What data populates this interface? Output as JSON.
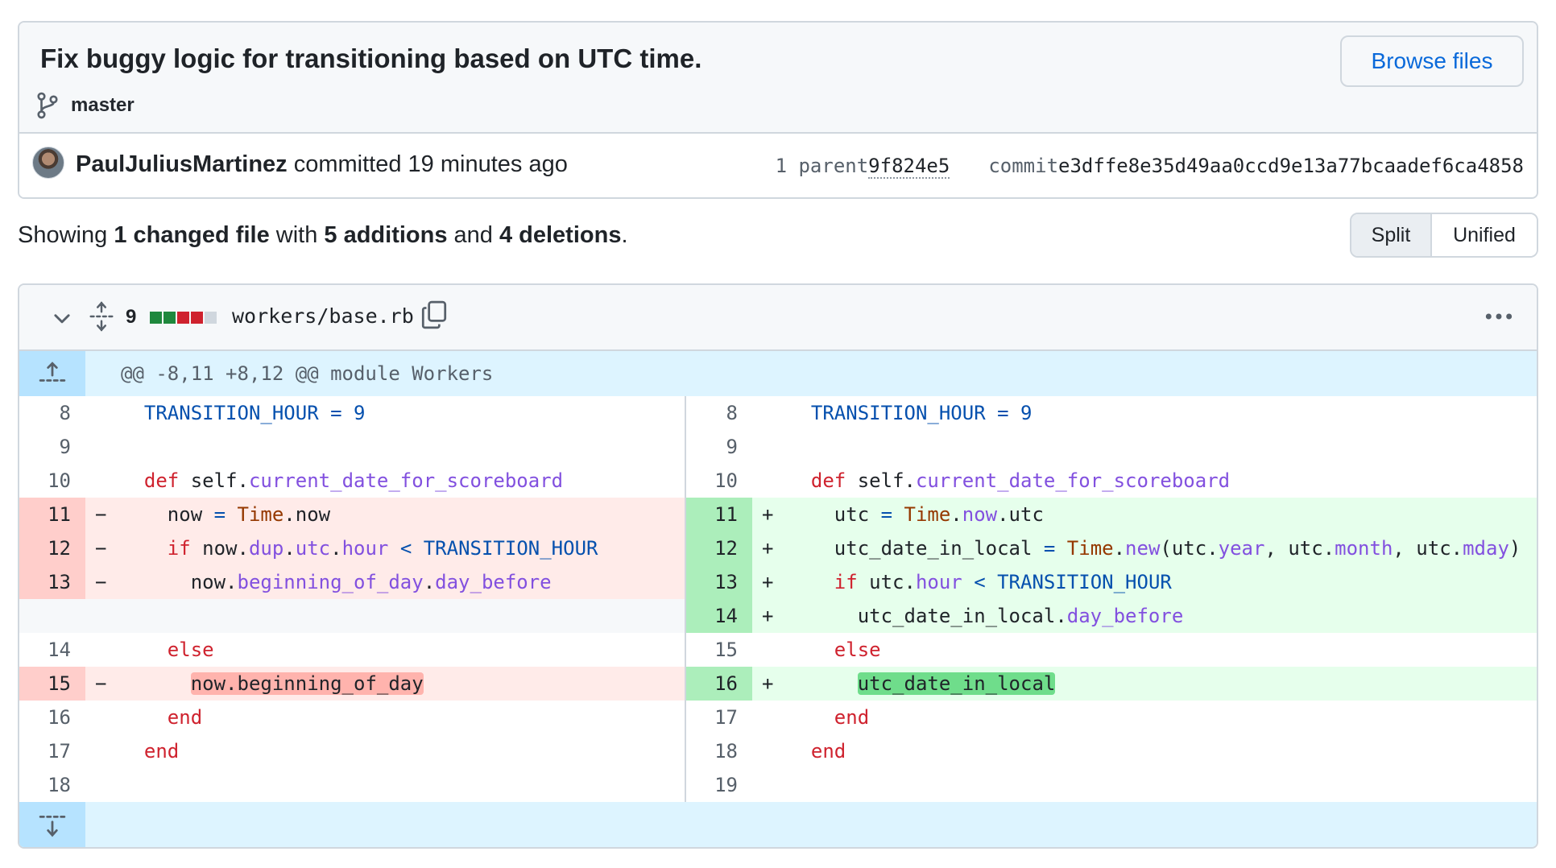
{
  "commit": {
    "title": "Fix buggy logic for transitioning based on UTC time.",
    "branch": "master",
    "browse_files_label": "Browse files",
    "author": "PaulJuliusMartinez",
    "action_time": " committed 19 minutes ago",
    "parent_label": "1 parent ",
    "parent_sha": "9f824e5",
    "commit_label": "commit ",
    "commit_sha": "e3dffe8e35d49aa0ccd9e13a77bcaadef6ca4858"
  },
  "summary": {
    "prefix": "Showing ",
    "files_changed": "1 changed file",
    "with": " with ",
    "additions": "5 additions",
    "and": " and ",
    "deletions": "4 deletions",
    "suffix": "."
  },
  "view_toggle": {
    "split": "Split",
    "unified": "Unified"
  },
  "file": {
    "changes": "9",
    "diffstat": [
      "add",
      "add",
      "del",
      "del",
      "neutral"
    ],
    "path": "workers/base.rb",
    "hunk_header": "@@ -8,11 +8,12 @@ module Workers"
  },
  "icons": {
    "branch": "git-branch-icon",
    "chevron": "chevron-down-icon",
    "expand": "unfold-icon",
    "copy": "copy-icon",
    "kebab": "kebab-horizontal-icon",
    "expand_up": "fold-up-icon",
    "expand_down": "fold-down-icon"
  },
  "colors": {
    "link": "#0969da",
    "add_bg": "#e6ffec",
    "add_num_bg": "#aceebb",
    "del_bg": "#ffebe9",
    "del_num_bg": "#ffcecb",
    "hunk_bg": "#ddf4ff"
  },
  "diff": {
    "left": [
      {
        "type": "ctx",
        "ln": "8",
        "sign": "",
        "tokens": [
          [
            "",
            "  "
          ],
          [
            "c",
            "TRANSITION_HOUR"
          ],
          [
            "",
            " "
          ],
          [
            "c",
            "="
          ],
          [
            "",
            " "
          ],
          [
            "c",
            "9"
          ]
        ]
      },
      {
        "type": "ctx",
        "ln": "9",
        "sign": "",
        "tokens": []
      },
      {
        "type": "ctx",
        "ln": "10",
        "sign": "",
        "tokens": [
          [
            "",
            "  "
          ],
          [
            "k",
            "def"
          ],
          [
            "",
            " self."
          ],
          [
            "m",
            "current_date_for_scoreboard"
          ]
        ]
      },
      {
        "type": "del",
        "ln": "11",
        "sign": "−",
        "tokens": [
          [
            "",
            "    now "
          ],
          [
            "c",
            "="
          ],
          [
            "",
            " "
          ],
          [
            "t",
            "Time"
          ],
          [
            "",
            ".now"
          ]
        ]
      },
      {
        "type": "del",
        "ln": "12",
        "sign": "−",
        "tokens": [
          [
            "",
            "    "
          ],
          [
            "k",
            "if"
          ],
          [
            "",
            " now."
          ],
          [
            "m",
            "dup"
          ],
          [
            "",
            "."
          ],
          [
            "m",
            "utc"
          ],
          [
            "",
            "."
          ],
          [
            "m",
            "hour"
          ],
          [
            "",
            " "
          ],
          [
            "c",
            "<"
          ],
          [
            "",
            " "
          ],
          [
            "c",
            "TRANSITION_HOUR"
          ]
        ]
      },
      {
        "type": "del",
        "ln": "13",
        "sign": "−",
        "tokens": [
          [
            "",
            "      now."
          ],
          [
            "m",
            "beginning_of_day"
          ],
          [
            "",
            "."
          ],
          [
            "m",
            "day_before"
          ]
        ]
      },
      {
        "type": "empty",
        "ln": "",
        "sign": "",
        "tokens": []
      },
      {
        "type": "ctx",
        "ln": "14",
        "sign": "",
        "tokens": [
          [
            "",
            "    "
          ],
          [
            "k",
            "else"
          ]
        ]
      },
      {
        "type": "del",
        "ln": "15",
        "sign": "−",
        "tokens": [
          [
            "",
            "      "
          ],
          [
            "hd",
            "now.beginning_of_day"
          ]
        ]
      },
      {
        "type": "ctx",
        "ln": "16",
        "sign": "",
        "tokens": [
          [
            "",
            "    "
          ],
          [
            "k",
            "end"
          ]
        ]
      },
      {
        "type": "ctx",
        "ln": "17",
        "sign": "",
        "tokens": [
          [
            "",
            "  "
          ],
          [
            "k",
            "end"
          ]
        ]
      },
      {
        "type": "ctx",
        "ln": "18",
        "sign": "",
        "tokens": []
      }
    ],
    "right": [
      {
        "type": "ctx",
        "ln": "8",
        "sign": "",
        "tokens": [
          [
            "",
            "  "
          ],
          [
            "c",
            "TRANSITION_HOUR"
          ],
          [
            "",
            " "
          ],
          [
            "c",
            "="
          ],
          [
            "",
            " "
          ],
          [
            "c",
            "9"
          ]
        ]
      },
      {
        "type": "ctx",
        "ln": "9",
        "sign": "",
        "tokens": []
      },
      {
        "type": "ctx",
        "ln": "10",
        "sign": "",
        "tokens": [
          [
            "",
            "  "
          ],
          [
            "k",
            "def"
          ],
          [
            "",
            " self."
          ],
          [
            "m",
            "current_date_for_scoreboard"
          ]
        ]
      },
      {
        "type": "add",
        "ln": "11",
        "sign": "+",
        "tokens": [
          [
            "",
            "    utc "
          ],
          [
            "c",
            "="
          ],
          [
            "",
            " "
          ],
          [
            "t",
            "Time"
          ],
          [
            "",
            "."
          ],
          [
            "m",
            "now"
          ],
          [
            "",
            ".utc"
          ]
        ]
      },
      {
        "type": "add",
        "ln": "12",
        "sign": "+",
        "tokens": [
          [
            "",
            "    utc_date_in_local "
          ],
          [
            "c",
            "="
          ],
          [
            "",
            " "
          ],
          [
            "t",
            "Time"
          ],
          [
            "",
            "."
          ],
          [
            "m",
            "new"
          ],
          [
            "",
            "(utc."
          ],
          [
            "m",
            "year"
          ],
          [
            "",
            ", utc."
          ],
          [
            "m",
            "month"
          ],
          [
            "",
            ", utc."
          ],
          [
            "m",
            "mday"
          ],
          [
            "",
            ")"
          ]
        ]
      },
      {
        "type": "add",
        "ln": "13",
        "sign": "+",
        "tokens": [
          [
            "",
            "    "
          ],
          [
            "k",
            "if"
          ],
          [
            "",
            " utc."
          ],
          [
            "m",
            "hour"
          ],
          [
            "",
            " "
          ],
          [
            "c",
            "<"
          ],
          [
            "",
            " "
          ],
          [
            "c",
            "TRANSITION_HOUR"
          ]
        ]
      },
      {
        "type": "add",
        "ln": "14",
        "sign": "+",
        "tokens": [
          [
            "",
            "      utc_date_in_local."
          ],
          [
            "m",
            "day_before"
          ]
        ]
      },
      {
        "type": "ctx",
        "ln": "15",
        "sign": "",
        "tokens": [
          [
            "",
            "    "
          ],
          [
            "k",
            "else"
          ]
        ]
      },
      {
        "type": "add",
        "ln": "16",
        "sign": "+",
        "tokens": [
          [
            "",
            "      "
          ],
          [
            "ha",
            "utc_date_in_local"
          ]
        ]
      },
      {
        "type": "ctx",
        "ln": "17",
        "sign": "",
        "tokens": [
          [
            "",
            "    "
          ],
          [
            "k",
            "end"
          ]
        ]
      },
      {
        "type": "ctx",
        "ln": "18",
        "sign": "",
        "tokens": [
          [
            "",
            "  "
          ],
          [
            "k",
            "end"
          ]
        ]
      },
      {
        "type": "ctx",
        "ln": "19",
        "sign": "",
        "tokens": []
      }
    ]
  }
}
